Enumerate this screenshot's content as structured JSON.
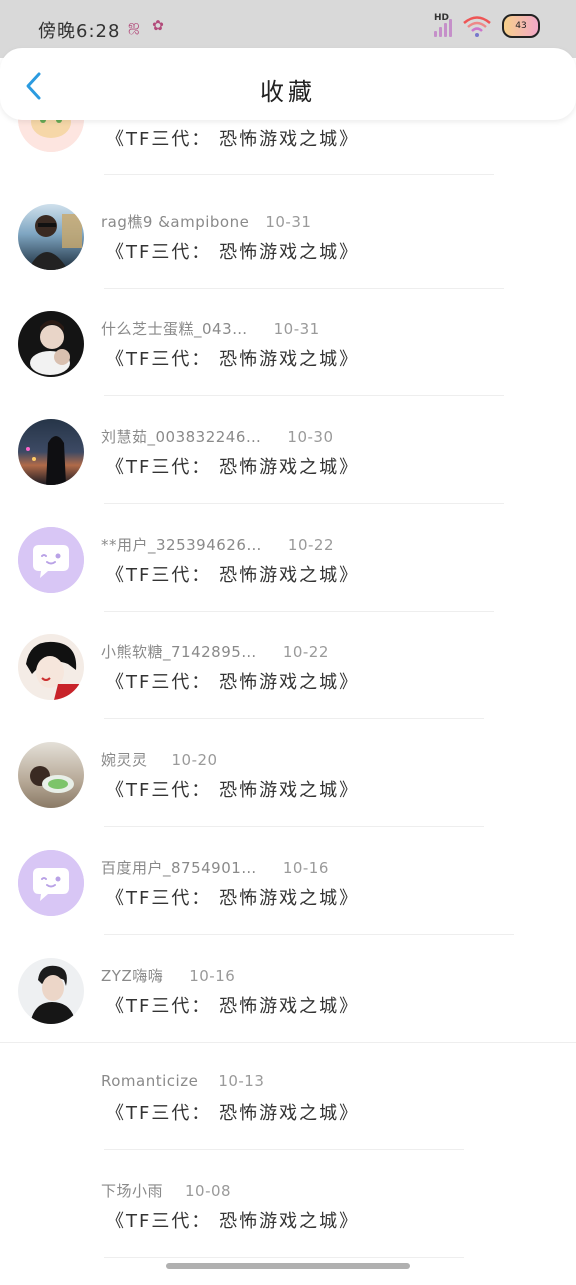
{
  "status_bar": {
    "time": "傍晚6:28",
    "network": "HD",
    "battery": "43"
  },
  "header": {
    "title": "收藏"
  },
  "colors": {
    "accent": "#2b9be0",
    "placeholder_avatar": "#d8c6f5"
  },
  "items": [
    {
      "user": "",
      "date": "",
      "title": "《TF三代： 恐怖游戏之城》",
      "avatar": "cartoon-avatar-icon"
    },
    {
      "user": "rag樵9 &ampibone",
      "date": "10-31",
      "title": "《TF三代： 恐怖游戏之城》",
      "avatar": "user-photo"
    },
    {
      "user": "什么芝士蛋糕_043…",
      "date": "10-31",
      "title": "《TF三代： 恐怖游戏之城》",
      "avatar": "user-photo"
    },
    {
      "user": "刘慧茹_003832246…",
      "date": "10-30",
      "title": "《TF三代： 恐怖游戏之城》",
      "avatar": "user-photo"
    },
    {
      "user": "**用户_325394626…",
      "date": "10-22",
      "title": "《TF三代： 恐怖游戏之城》",
      "avatar": "default-chat-avatar-icon"
    },
    {
      "user": "小熊软糖_7142895…",
      "date": "10-22",
      "title": "《TF三代： 恐怖游戏之城》",
      "avatar": "illustration-avatar"
    },
    {
      "user": "婉灵灵",
      "date": "10-20",
      "title": "《TF三代： 恐怖游戏之城》",
      "avatar": "user-photo"
    },
    {
      "user": "百度用户_8754901…",
      "date": "10-16",
      "title": "《TF三代： 恐怖游戏之城》",
      "avatar": "default-chat-avatar-icon"
    },
    {
      "user": "ZYZ嗨嗨",
      "date": "10-16",
      "title": "《TF三代： 恐怖游戏之城》",
      "avatar": "user-photo"
    },
    {
      "user": "Romanticize",
      "date": "10-13",
      "title": "《TF三代： 恐怖游戏之城》",
      "avatar": "none"
    },
    {
      "user": "下场小雨",
      "date": "10-08",
      "title": "《TF三代： 恐怖游戏之城》",
      "avatar": "none"
    }
  ]
}
